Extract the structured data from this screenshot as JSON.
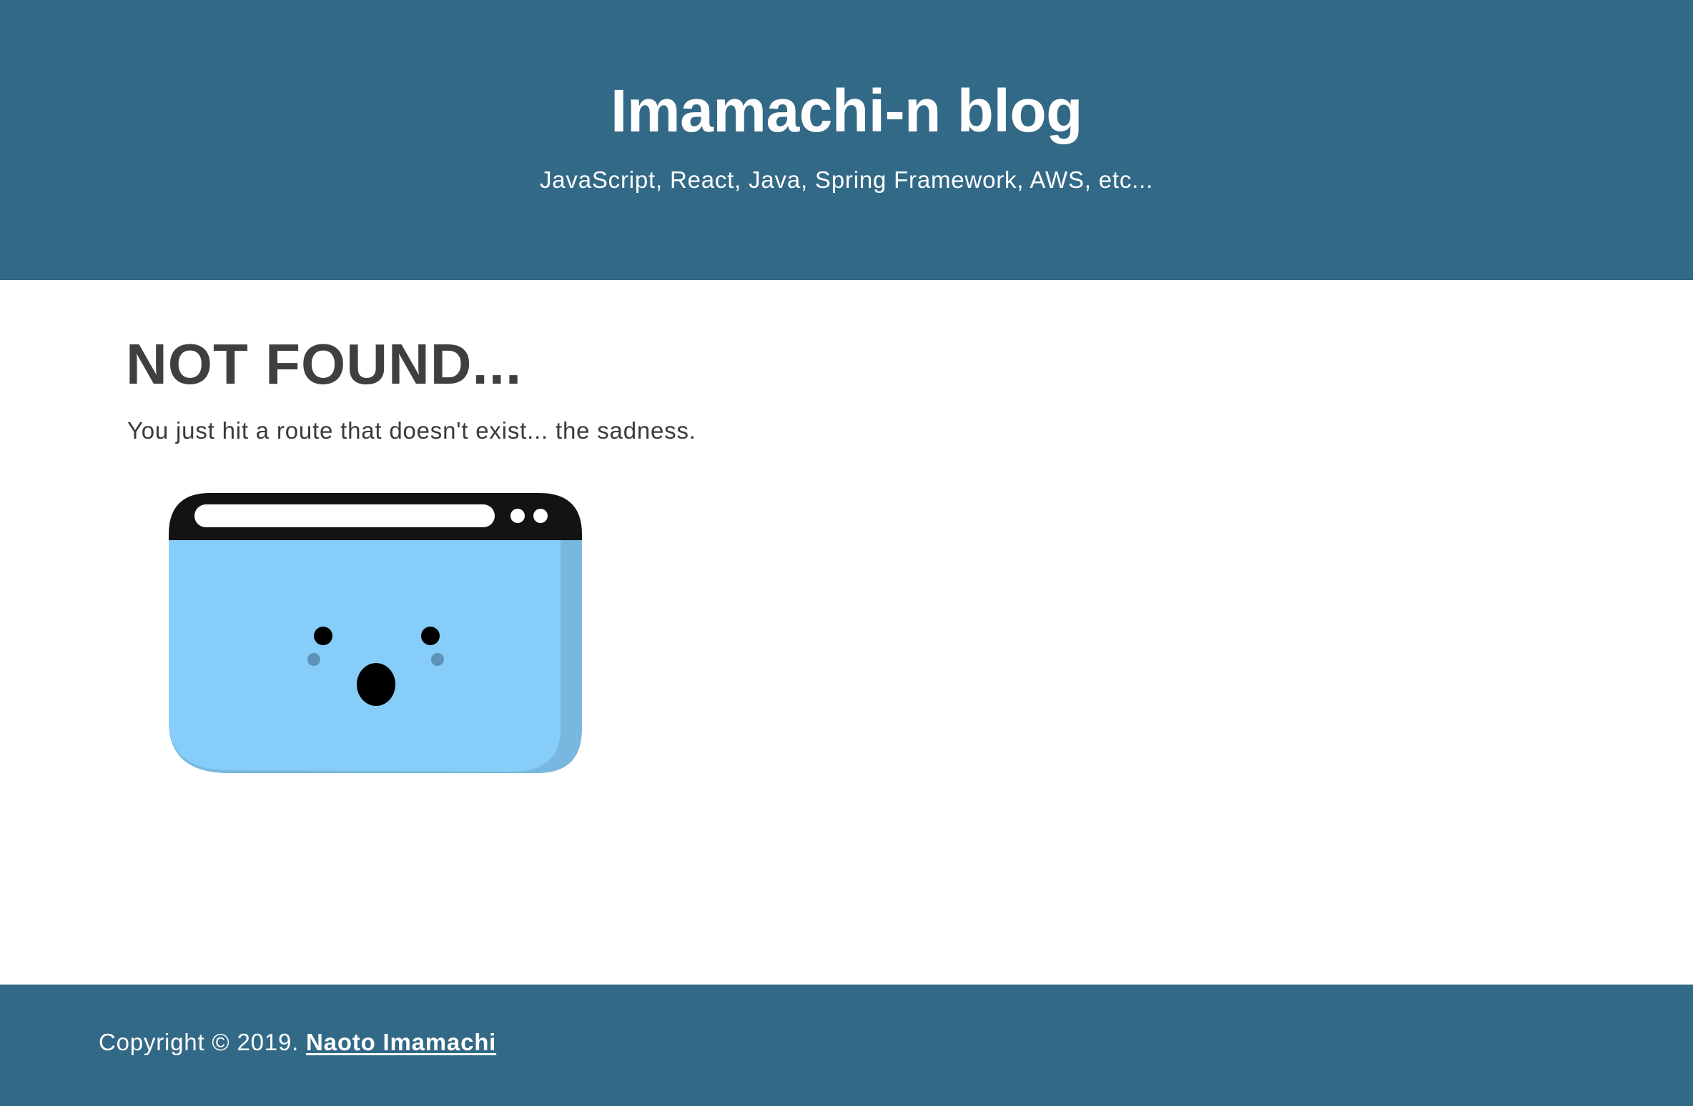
{
  "header": {
    "title": "Imamachi-n blog",
    "subtitle": "JavaScript, React, Java, Spring Framework, AWS, etc..."
  },
  "main": {
    "heading": "NOT FOUND...",
    "message": "You just hit a route that doesn't exist... the sadness.",
    "illustration_icon": "sad-browser-window-icon"
  },
  "footer": {
    "copyright": "Copyright © 2019.",
    "author_link": "Naoto Imamachi"
  },
  "colors": {
    "header_bg": "#326986",
    "footer_bg": "#326986",
    "heading_text": "#3f3f3f",
    "illustration_body": "#87cdfa",
    "illustration_shade": "#78b8e0",
    "illustration_bar": "#131313"
  }
}
